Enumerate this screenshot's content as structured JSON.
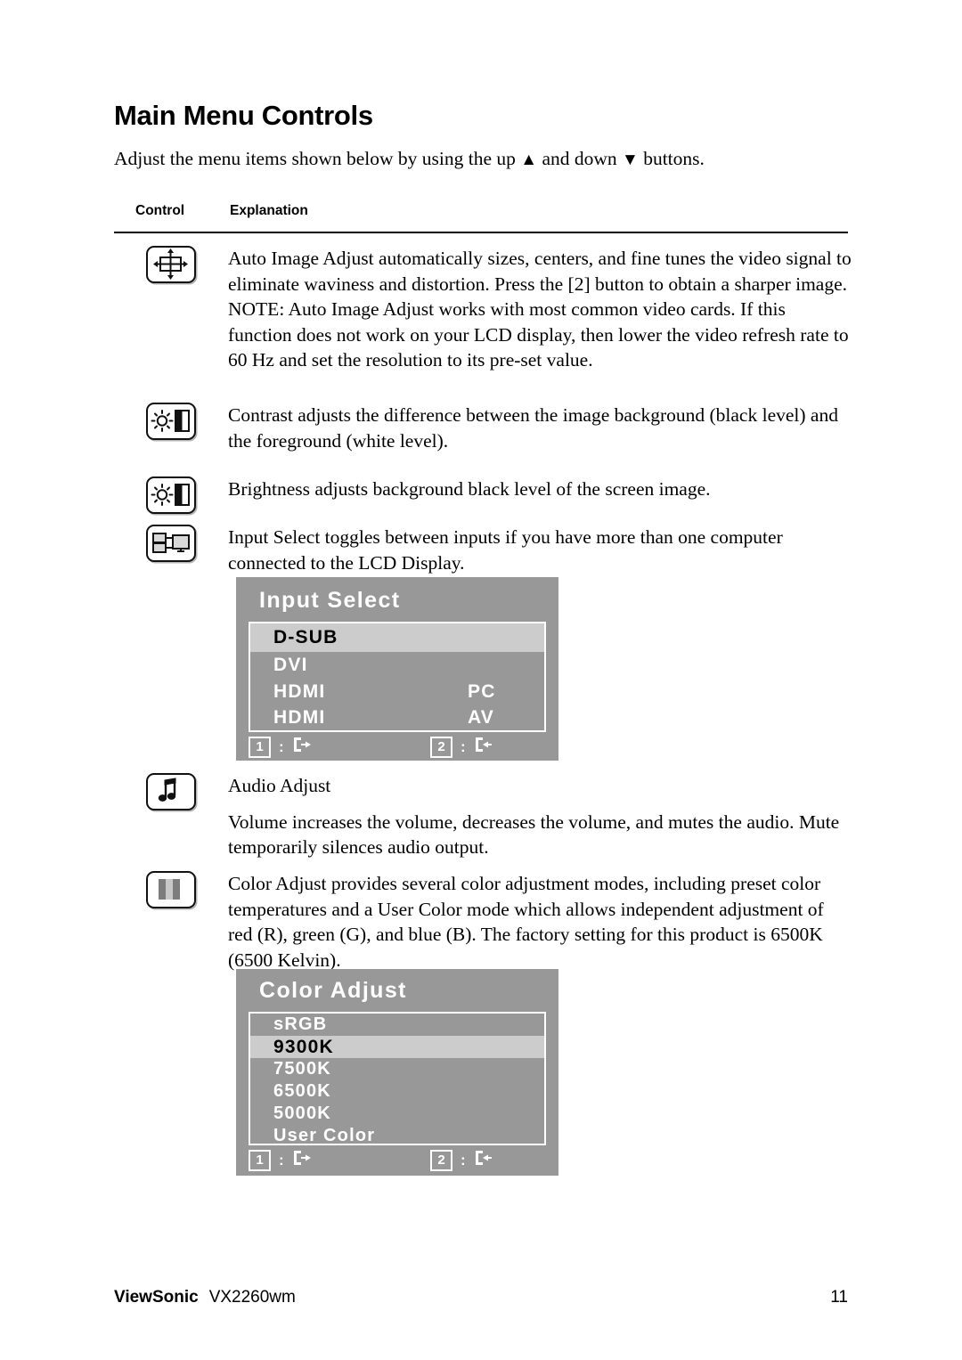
{
  "document": {
    "title": "Main Menu Controls",
    "intro_before": "Adjust the menu items shown below by using the up ",
    "intro_up_glyph": "▲",
    "intro_middle": " and down ",
    "intro_down_glyph": "▼",
    "intro_after": " buttons."
  },
  "table": {
    "col_control": "Control",
    "col_explanation": "Explanation"
  },
  "rows": [
    {
      "icon": "auto-image-adjust-icon",
      "paragraphs": [
        "Auto Image Adjust automatically sizes, centers, and fine tunes the video signal to eliminate waviness and distortion. Press the [2] button to obtain a sharper image.",
        "NOTE: Auto Image Adjust works with most common video cards. If this function does not work on your LCD display, then lower the video refresh rate to 60 Hz and set the resolution to its pre-set value."
      ]
    },
    {
      "icon": "contrast-icon",
      "paragraphs": [
        "Contrast adjusts the difference between the image background  (black level) and the foreground (white level)."
      ]
    },
    {
      "icon": "brightness-icon",
      "paragraphs": [
        "Brightness adjusts background black level of the screen image."
      ]
    },
    {
      "icon": "input-select-icon",
      "paragraphs": [
        "Input Select toggles between inputs if you have more than one computer connected to the LCD Display."
      ]
    },
    {
      "icon": "audio-adjust-icon",
      "paragraphs": [
        "Audio Adjust",
        "Volume increases the volume, decreases the volume, and mutes the audio. Mute temporarily silences audio output."
      ]
    },
    {
      "icon": "color-adjust-icon",
      "paragraphs": [
        "Color Adjust provides several color adjustment modes, including preset color temperatures and a User Color mode which allows independent adjustment of red (R), green (G), and blue (B). The factory setting for this product is 6500K (6500 Kelvin)."
      ]
    }
  ],
  "osd_input_select": {
    "title": "Input Select",
    "items": [
      {
        "label": "D-SUB",
        "value": "",
        "selected": true
      },
      {
        "label": "DVI",
        "value": "",
        "selected": false
      },
      {
        "label": "HDMI",
        "value": "PC",
        "selected": false
      },
      {
        "label": "HDMI",
        "value": "AV",
        "selected": false
      }
    ],
    "footer": {
      "key1": "1",
      "key1_separator": ":",
      "key1_icon": "exit-icon",
      "key2": "2",
      "key2_separator": ":",
      "key2_icon": "enter-icon"
    }
  },
  "osd_color_adjust": {
    "title": "Color Adjust",
    "items": [
      {
        "label": "sRGB",
        "value": "",
        "selected": false
      },
      {
        "label": "9300K",
        "value": "",
        "selected": true
      },
      {
        "label": "7500K",
        "value": "",
        "selected": false
      },
      {
        "label": "6500K",
        "value": "",
        "selected": false
      },
      {
        "label": "5000K",
        "value": "",
        "selected": false
      },
      {
        "label": "User Color",
        "value": "",
        "selected": false
      }
    ],
    "footer": {
      "key1": "1",
      "key1_separator": ":",
      "key1_icon": "exit-icon",
      "key2": "2",
      "key2_separator": ":",
      "key2_icon": "enter-icon"
    }
  },
  "footer": {
    "brand": "ViewSonic",
    "model": "VX2260wm",
    "page_number": "11"
  },
  "colors": {
    "osd_background": "#989898",
    "osd_selected_row": "#cccccc",
    "osd_text": "#ffffff",
    "osd_selected_text": "#000000",
    "page_text": "#000000"
  }
}
